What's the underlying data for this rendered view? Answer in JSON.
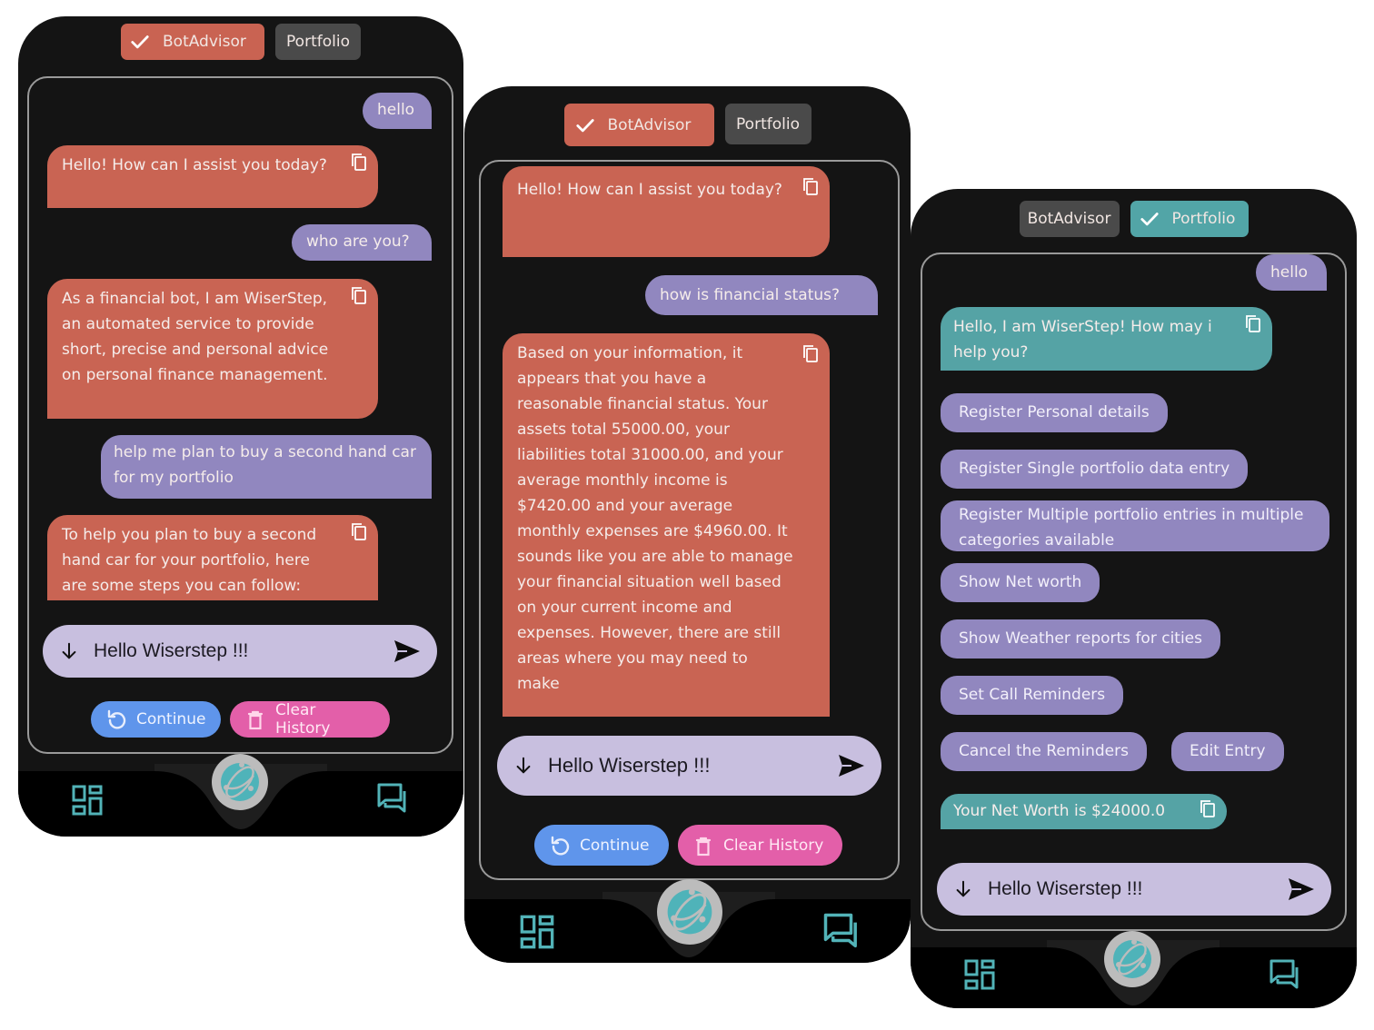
{
  "colors": {
    "bot_bubble": "#c96453",
    "bot_bubble_teal": "#55a3a5",
    "user_bubble": "#9187bf",
    "composer": "#c8bfdf",
    "continue": "#5f95eb",
    "clear_history": "#e35fa9",
    "accent_teal": "#52b3b8",
    "tab_inactive": "#4a4a4a"
  },
  "screens": [
    {
      "tabs": [
        {
          "label": "BotAdvisor",
          "active": true
        },
        {
          "label": "Portfolio",
          "active": false
        }
      ],
      "messages": [
        {
          "role": "user",
          "text": "hello"
        },
        {
          "role": "bot",
          "text": "Hello! How can I assist you today?"
        },
        {
          "role": "user",
          "text": "who are you?"
        },
        {
          "role": "bot",
          "text": "As a financial bot, I am WiserStep, an automated service to provide short, precise and personal advice on personal finance management."
        },
        {
          "role": "user",
          "text": "help me plan to buy a second hand car for my portfolio"
        },
        {
          "role": "bot",
          "text": "To help you plan to buy a second hand car for your portfolio, here are some steps you can follow:"
        }
      ],
      "composer": {
        "value": "Hello Wiserstep !!!"
      },
      "actions": {
        "continue": "Continue",
        "clear": "Clear History"
      }
    },
    {
      "tabs": [
        {
          "label": "BotAdvisor",
          "active": true
        },
        {
          "label": "Portfolio",
          "active": false
        }
      ],
      "messages": [
        {
          "role": "bot",
          "text": "Hello! How can I assist you today?"
        },
        {
          "role": "user",
          "text": "how is financial status?"
        },
        {
          "role": "bot",
          "text": "Based on your information, it appears that you have a reasonable financial status. Your assets total 55000.00, your liabilities total 31000.00, and your average monthly income is $7420.00 and your average monthly expenses are $4960.00. It sounds like you are able to manage your financial situation well based on your current income and expenses. However, there are still areas where you may need to make"
        }
      ],
      "composer": {
        "value": "Hello Wiserstep !!!"
      },
      "actions": {
        "continue": "Continue",
        "clear": "Clear History"
      }
    },
    {
      "tabs": [
        {
          "label": "BotAdvisor",
          "active": false
        },
        {
          "label": "Portfolio",
          "active": true
        }
      ],
      "messages": [
        {
          "role": "user",
          "text": "hello"
        },
        {
          "role": "bot",
          "text": "Hello, I am WiserStep! How may i help you?"
        },
        {
          "role": "bot",
          "text": "Your Net Worth is $24000.0"
        }
      ],
      "options": [
        "Register Personal details",
        "Register Single portfolio data entry",
        "Register Multiple portfolio entries in multiple categories available",
        "Show Net worth",
        "Show Weather reports for cities",
        "Set Call Reminders",
        "Cancel the Reminders",
        "Edit Entry"
      ],
      "composer": {
        "value": "Hello Wiserstep !!!"
      }
    }
  ]
}
